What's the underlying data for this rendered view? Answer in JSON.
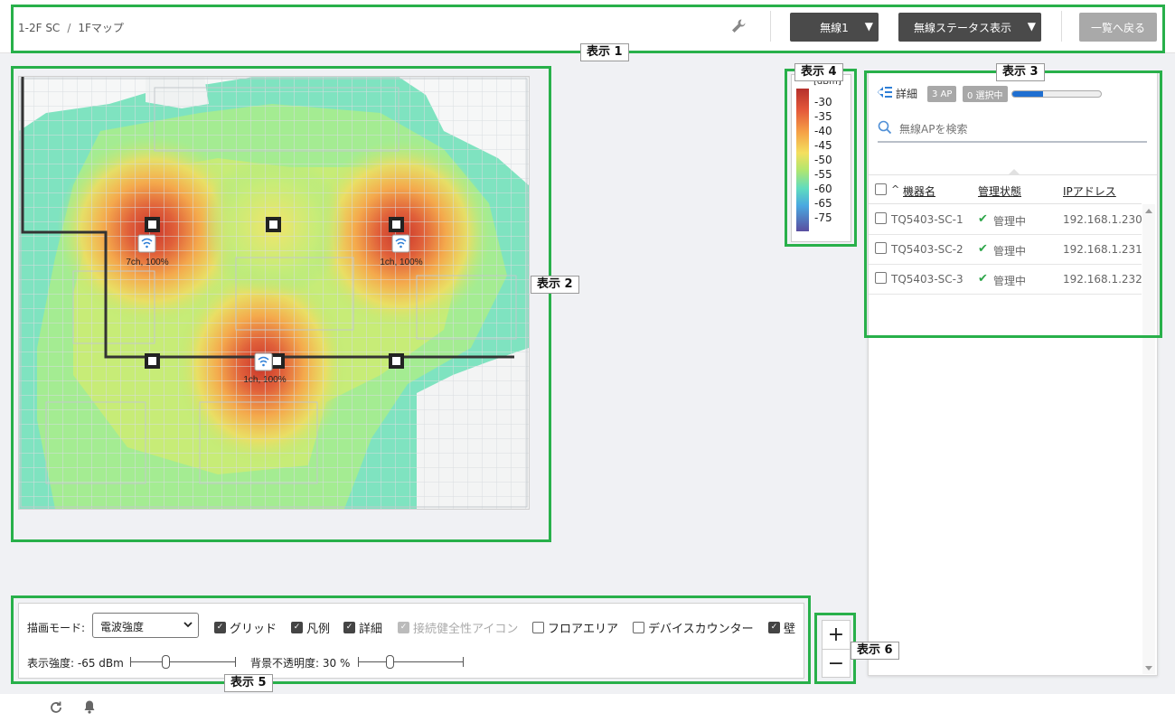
{
  "breadcrumb": {
    "site": "1-2F SC",
    "separator": "/",
    "map": "1Fマップ"
  },
  "toolbar": {
    "radio_select": "無線1",
    "status_display": "無線ステータス表示",
    "back": "一覧へ戻る"
  },
  "map": {
    "ap_labels": [
      "7ch, 100%",
      "1ch, 100%",
      "1ch, 100%"
    ]
  },
  "legend": {
    "unit": "[dBm]",
    "values": [
      "-30",
      "-35",
      "-40",
      "-45",
      "-50",
      "-55",
      "-60",
      "-65",
      "-75"
    ]
  },
  "panel": {
    "details_label": "詳細",
    "ap_count": "3 AP",
    "selected_count": "0 選択中",
    "progress": 0.35,
    "search_placeholder": "無線APを検索",
    "columns": {
      "sort_marker": "^",
      "device_name": "機器名",
      "management": "管理状態",
      "ip": "IPアドレス"
    },
    "rows": [
      {
        "name": "TQ5403-SC-1",
        "status": "管理中",
        "ip": "192.168.1.230"
      },
      {
        "name": "TQ5403-SC-2",
        "status": "管理中",
        "ip": "192.168.1.231"
      },
      {
        "name": "TQ5403-SC-3",
        "status": "管理中",
        "ip": "192.168.1.232"
      }
    ]
  },
  "controls": {
    "draw_mode_label": "描画モード:",
    "draw_mode_value": "電波強度",
    "checkboxes": {
      "grid": "グリッド",
      "legend": "凡例",
      "details": "詳細",
      "health_icon": "接続健全性アイコン",
      "floor_area": "フロアエリア",
      "device_counter": "デバイスカウンター",
      "wall": "壁"
    },
    "strength_label": "表示強度: -65 dBm",
    "strength_level": 0.33,
    "opacity_label": "背景不透明度: 30 %",
    "opacity_level": 0.3
  },
  "zoom": {
    "in": "+",
    "out": "−"
  },
  "annotations": {
    "a1": "表示 1",
    "a2": "表示 2",
    "a3": "表示 3",
    "a4": "表示 4",
    "a5": "表示 5",
    "a6": "表示 6"
  },
  "colors": {
    "outline": "#28b04a",
    "dark_button": "#4a4a4a",
    "accent": "#2f7fd6"
  }
}
